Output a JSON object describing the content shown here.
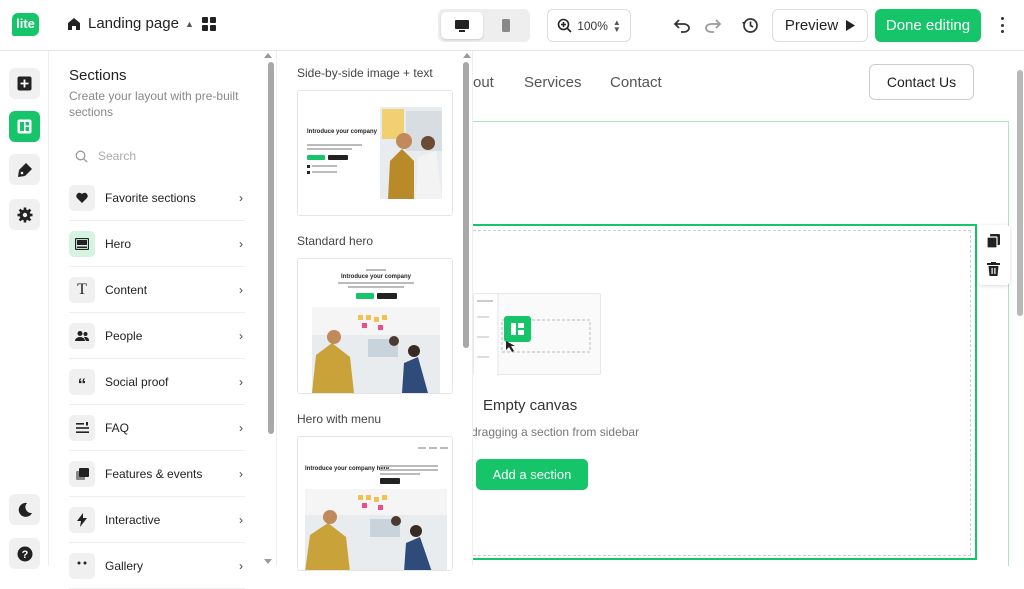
{
  "topbar": {
    "logo": "lite",
    "page_name": "Landing page",
    "zoom": "100%",
    "preview_label": "Preview",
    "done_label": "Done editing",
    "accent": "#16c46a"
  },
  "rail": {
    "items": [
      "add-icon",
      "layout-icon",
      "brush-icon",
      "settings-icon",
      "moon-icon",
      "help-icon"
    ],
    "active": "layout-icon"
  },
  "sections_panel": {
    "title": "Sections",
    "subtitle": "Create your layout with pre-built sections",
    "search_placeholder": "Search",
    "items": [
      {
        "label": "Favorite sections",
        "icon": "heart-icon"
      },
      {
        "label": "Hero",
        "icon": "hero-icon"
      },
      {
        "label": "Content",
        "icon": "text-icon"
      },
      {
        "label": "People",
        "icon": "people-icon"
      },
      {
        "label": "Social proof",
        "icon": "quote-icon"
      },
      {
        "label": "FAQ",
        "icon": "faq-icon"
      },
      {
        "label": "Features & events",
        "icon": "features-icon"
      },
      {
        "label": "Interactive",
        "icon": "bolt-icon"
      },
      {
        "label": "Gallery",
        "icon": "gallery-icon"
      }
    ]
  },
  "templates_panel": {
    "items": [
      {
        "title": "Side-by-side image + text",
        "heading": "Introduce your company"
      },
      {
        "title": "Standard hero",
        "heading": "Introduce your company"
      },
      {
        "title": "Hero with menu",
        "heading": "Introduce your company here"
      }
    ]
  },
  "canvas": {
    "nav": [
      "out",
      "Services",
      "Contact"
    ],
    "contact_button": "Contact Us",
    "empty_title": "Empty canvas",
    "empty_subtitle": "dragging a section from sidebar",
    "add_section_label": "Add a section"
  }
}
